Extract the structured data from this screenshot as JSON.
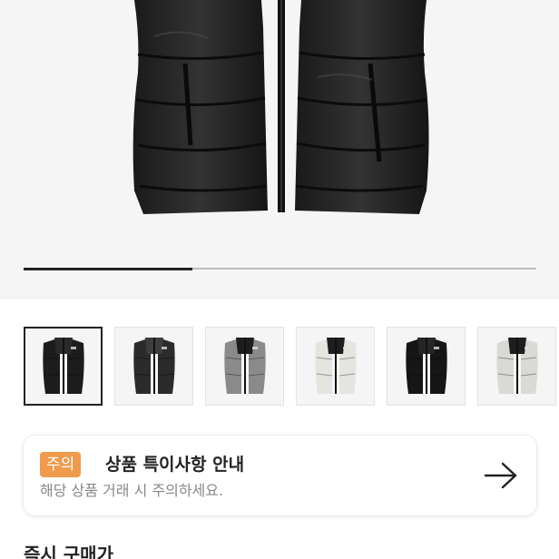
{
  "gallery": {
    "image_progress": 0.33,
    "thumbnails": [
      {
        "colorway": "black",
        "selected": true
      },
      {
        "colorway": "charcoal",
        "selected": false
      },
      {
        "colorway": "grey",
        "selected": false
      },
      {
        "colorway": "ivory",
        "selected": false
      },
      {
        "colorway": "black-glossy",
        "selected": false
      },
      {
        "colorway": "light-grey",
        "selected": false
      }
    ]
  },
  "notice": {
    "badge": "주의",
    "title": "상품 특이사항 안내",
    "description": "해당 상품 거래 시 주의하세요.",
    "arrow_icon": "arrow-right-icon"
  },
  "purchase": {
    "section_title": "즉시 구매가"
  },
  "colors": {
    "badge": "#ef9a4c",
    "accent_dark": "#222222",
    "muted_text": "#888888"
  }
}
